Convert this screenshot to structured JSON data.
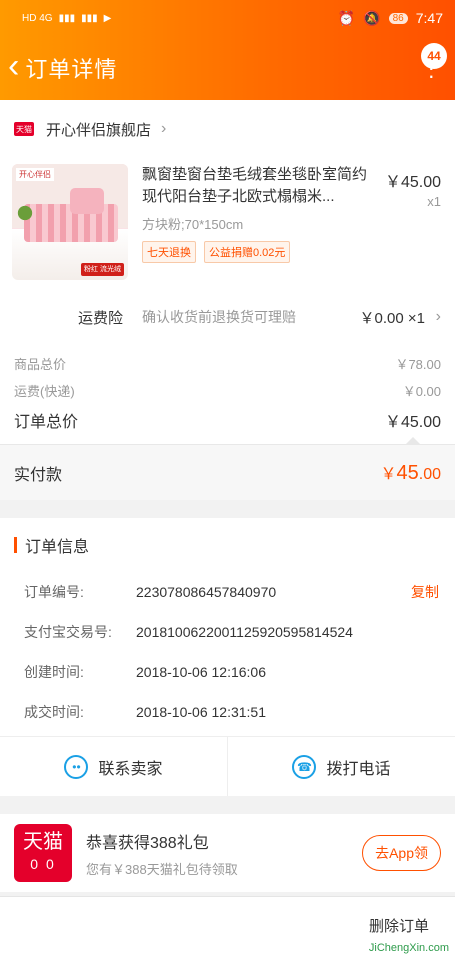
{
  "status_bar": {
    "network": "HD 4G",
    "battery": "86",
    "time": "7:47"
  },
  "header": {
    "title": "订单详情",
    "message_count": "44"
  },
  "shop": {
    "name": "开心伴侣旗舰店"
  },
  "product": {
    "name": "飘窗垫窗台垫毛绒套坐毯卧室简约现代阳台垫子北欧式榻榻米...",
    "price": "￥45.00",
    "qty": "x1",
    "sku": "方块粉;70*150cm",
    "tags": [
      "七天退换",
      "公益捐赠0.02元"
    ],
    "thumb_brand": "开心伴侣",
    "thumb_tag": "粉红 流光绒"
  },
  "insurance": {
    "label": "运费险",
    "desc": "确认收货前退换货可理赔",
    "price": "￥0.00 ×1"
  },
  "summary": {
    "rows": [
      {
        "label": "商品总价",
        "value": "￥78.00"
      },
      {
        "label": "运费(快递)",
        "value": "￥0.00"
      }
    ],
    "total_label": "订单总价",
    "total_value": "￥45.00",
    "paid_label": "实付款",
    "paid_currency": "￥",
    "paid_amount": "45",
    "paid_decimals": ".00"
  },
  "order_info": {
    "title": "订单信息",
    "rows": [
      {
        "label": "订单编号:",
        "value": "223078086457840970"
      },
      {
        "label": "支付宝交易号:",
        "value": "2018100622001125920595814524"
      },
      {
        "label": "创建时间:",
        "value": "2018-10-06 12:16:06"
      },
      {
        "label": "成交时间:",
        "value": "2018-10-06 12:31:51"
      }
    ],
    "copy_label": "复制"
  },
  "contact": {
    "seller_label": "联系卖家",
    "phone_label": "拨打电话"
  },
  "promo": {
    "logo_text": "天猫",
    "logo_sub": "0 0",
    "title": "恭喜获得388礼包",
    "subtitle": "您有￥388天猫礼包待领取",
    "button": "去App领"
  },
  "bottom": {
    "delete_label": "删除订单"
  },
  "watermark": "JiChengXin.com",
  "colors": {
    "accent": "#ff5000",
    "header_start": "#ff9a00",
    "link_blue": "#1aa0e5"
  }
}
